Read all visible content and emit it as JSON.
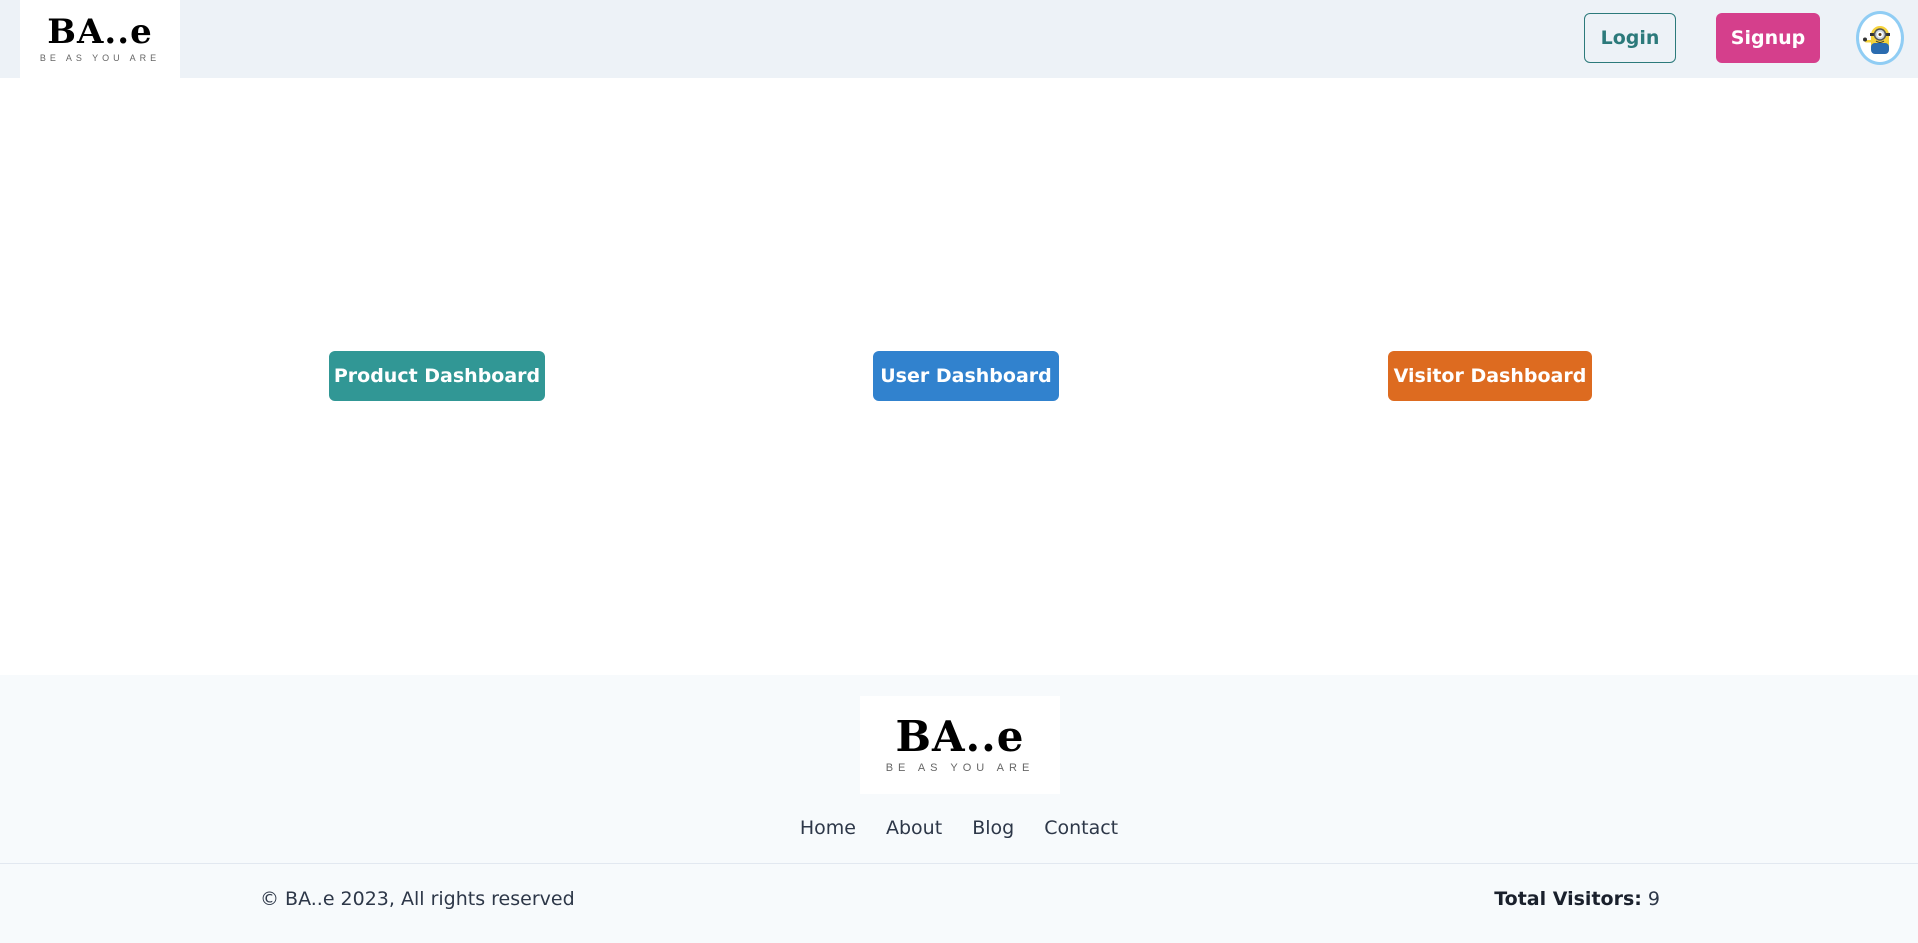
{
  "header": {
    "logo": {
      "mark": "BA..e",
      "tagline": "BE AS YOU ARE"
    },
    "login_label": "Login",
    "signup_label": "Signup",
    "avatar_icon": "minion-avatar-icon"
  },
  "main": {
    "buttons": [
      {
        "label": "Product Dashboard",
        "color": "#319795"
      },
      {
        "label": "User Dashboard",
        "color": "#3182ce"
      },
      {
        "label": "Visitor Dashboard",
        "color": "#dd6b20"
      }
    ]
  },
  "footer": {
    "logo": {
      "mark": "BA..e",
      "tagline": "BE AS YOU ARE"
    },
    "nav": [
      "Home",
      "About",
      "Blog",
      "Contact"
    ],
    "copyright": "© BA..e 2023, All rights reserved",
    "visitors_label": "Total Visitors:",
    "visitors_count": "9"
  },
  "colors": {
    "header_bg": "#edf2f7",
    "footer_bg": "#f7fafc",
    "login": "#2c7a7b",
    "signup": "#d53f8c"
  }
}
